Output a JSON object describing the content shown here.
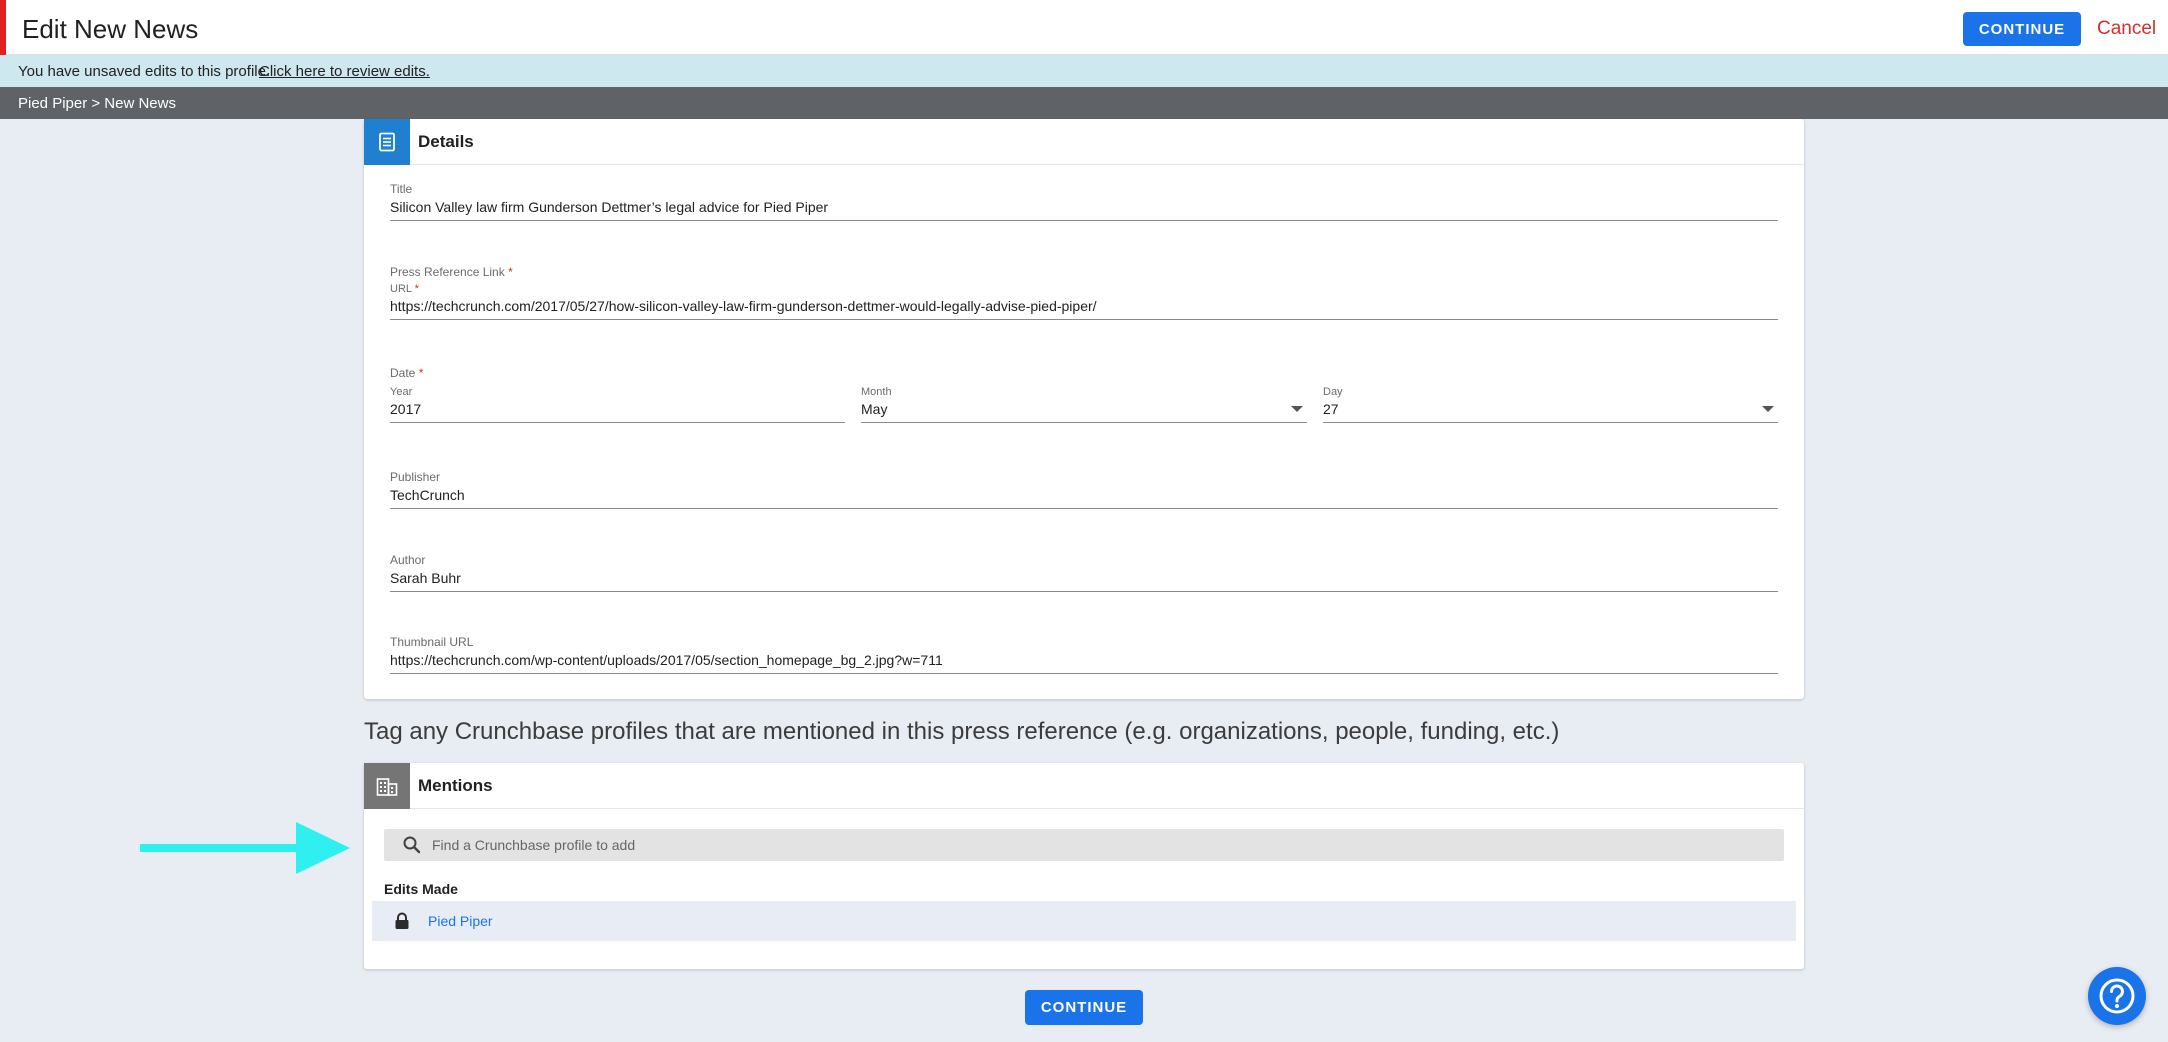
{
  "header": {
    "title": "Edit New News",
    "continue_label": "CONTINUE",
    "cancel_label": "Cancel",
    "accent_color": "#e0201f"
  },
  "banner": {
    "message": "You have unsaved edits to this profile.",
    "link_text": "Click here to review edits."
  },
  "breadcrumb": "Pied Piper > New News",
  "details": {
    "section_label": "Details",
    "section_icon": "document-icon",
    "title": {
      "label": "Title",
      "value": "Silicon Valley law firm Gunderson Dettmer’s legal advice for Pied Piper"
    },
    "press_link": {
      "label": "Press Reference Link",
      "url_label": "URL",
      "required_mark": "*",
      "value": "https://techcrunch.com/2017/05/27/how-silicon-valley-law-firm-gunderson-dettmer-would-legally-advise-pied-piper/"
    },
    "date": {
      "label": "Date",
      "year_label": "Year",
      "year": "2017",
      "month_label": "Month",
      "month": "May",
      "day_label": "Day",
      "day": "27"
    },
    "publisher": {
      "label": "Publisher",
      "value": "TechCrunch"
    },
    "author": {
      "label": "Author",
      "value": "Sarah Buhr"
    },
    "thumbnail": {
      "label": "Thumbnail URL",
      "value": "https://techcrunch.com/wp-content/uploads/2017/05/section_homepage_bg_2.jpg?w=711"
    }
  },
  "tagline": "Tag any Crunchbase profiles that are mentioned in this press reference (e.g. organizations, people, funding, etc.)",
  "mentions": {
    "section_label": "Mentions",
    "section_icon": "building-icon",
    "search_placeholder": "Find a Crunchbase profile to add",
    "edits_title": "Edits Made",
    "items": [
      {
        "name": "Pied Piper",
        "icon": "lock-icon"
      }
    ]
  },
  "footer": {
    "continue_label": "CONTINUE"
  },
  "colors": {
    "primary": "#1a73e8",
    "details_icon_bg": "#1f7fd1",
    "mentions_icon_bg": "#757575",
    "arrow": "#2ff0f0"
  }
}
